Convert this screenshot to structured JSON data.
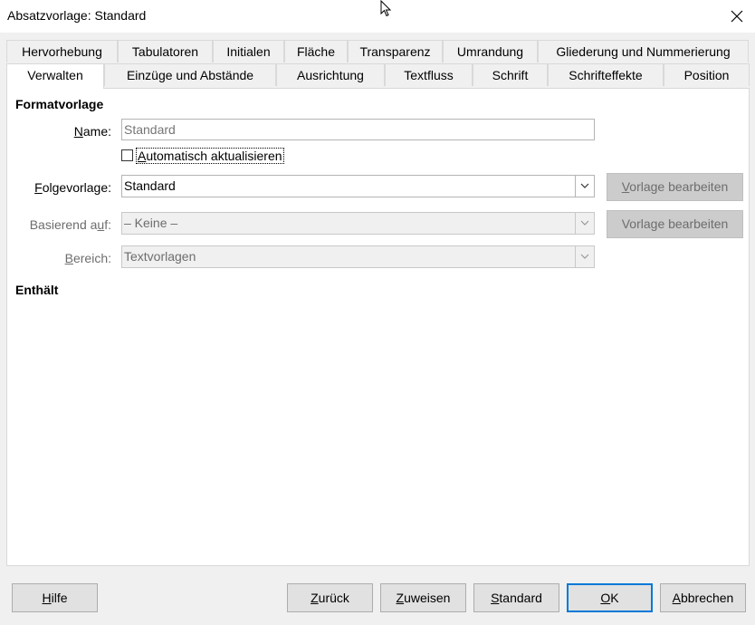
{
  "window": {
    "title": "Absatzvorlage: Standard"
  },
  "tabs_row1": [
    {
      "label": "Hervorhebung"
    },
    {
      "label": "Tabulatoren"
    },
    {
      "label": "Initialen"
    },
    {
      "label": "Fläche"
    },
    {
      "label": "Transparenz"
    },
    {
      "label": "Umrandung"
    },
    {
      "label": "Gliederung und Nummerierung"
    }
  ],
  "tabs_row2": [
    {
      "label": "Verwalten",
      "active": true
    },
    {
      "label": "Einzüge und Abstände"
    },
    {
      "label": "Ausrichtung"
    },
    {
      "label": "Textfluss"
    },
    {
      "label": "Schrift"
    },
    {
      "label": "Schrifteffekte"
    },
    {
      "label": "Position"
    }
  ],
  "formatvorlage": {
    "section_title": "Formatvorlage",
    "name": {
      "label_u": "N",
      "label_rest": "ame:",
      "placeholder": "Standard"
    },
    "auto_update": {
      "label_u": "A",
      "label_rest": "utomatisch aktualisieren",
      "checked": false
    },
    "folgevorlage": {
      "label_u": "F",
      "label_rest": "olgevorlage:",
      "value": "Standard",
      "edit_u": "V",
      "edit_rest": "orlage bearbeiten"
    },
    "basierend": {
      "label_pre": "Basierend a",
      "label_u": "u",
      "label_rest": "f:",
      "value": "– Keine –",
      "edit_pre": "Vorla",
      "edit_u": "g",
      "edit_rest": "e bearbeiten"
    },
    "bereich": {
      "label_u": "B",
      "label_rest": "ereich:",
      "value": "Textvorlagen"
    }
  },
  "enthaelt": {
    "section_title": "Enthält"
  },
  "buttons": {
    "hilfe": {
      "u": "H",
      "rest": "ilfe"
    },
    "zurueck": {
      "u": "Z",
      "rest": "urück"
    },
    "zuweisen": {
      "u": "Z",
      "rest": "uweisen"
    },
    "standard": {
      "u": "S",
      "rest": "tandard"
    },
    "ok": {
      "u": "O",
      "rest": "K"
    },
    "abbrechen": {
      "u": "A",
      "rest": "bbrechen"
    }
  }
}
